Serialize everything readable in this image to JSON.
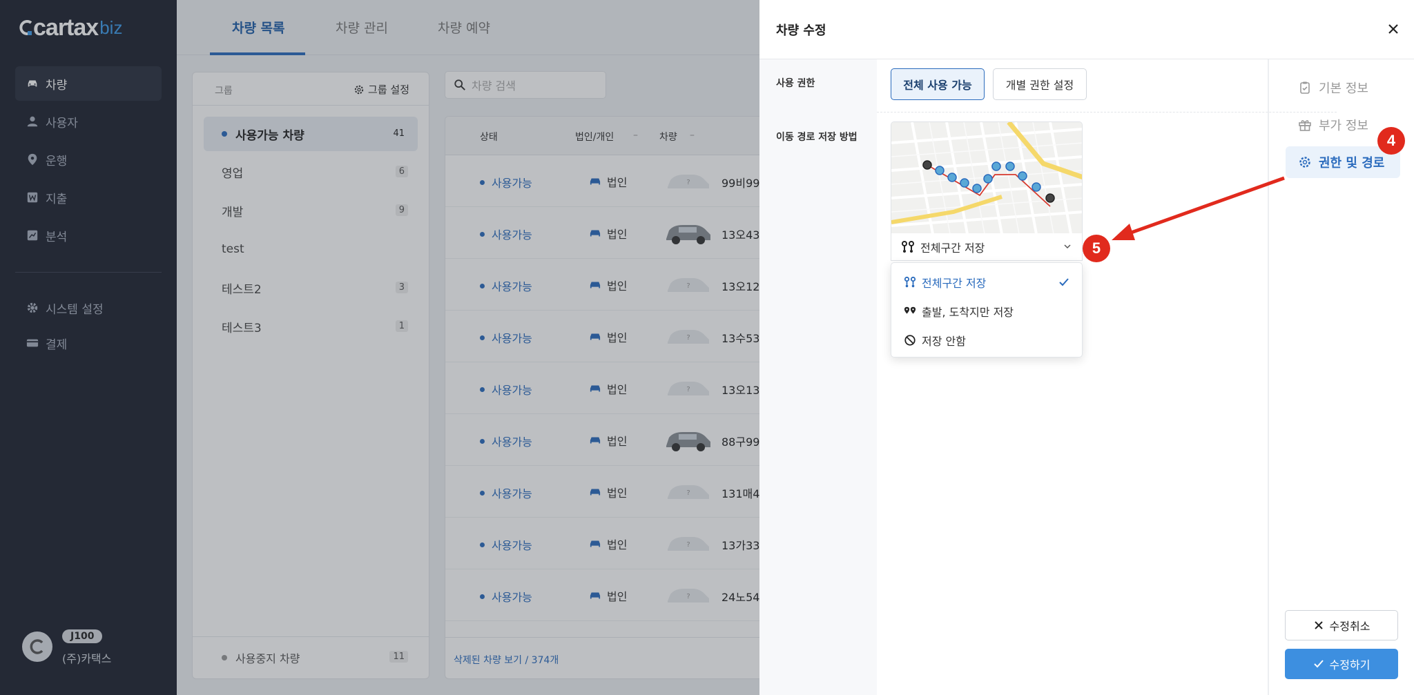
{
  "sidebar": {
    "logo": {
      "brand": "cartax",
      "suffix": "biz"
    },
    "items": [
      {
        "label": "차량",
        "icon": "car-icon"
      },
      {
        "label": "사용자",
        "icon": "user-icon"
      },
      {
        "label": "운행",
        "icon": "location-pin-icon"
      },
      {
        "label": "지출",
        "icon": "won-icon"
      },
      {
        "label": "분석",
        "icon": "chart-icon"
      },
      {
        "label": "시스템 설정",
        "icon": "gear-icon"
      },
      {
        "label": "결제",
        "icon": "card-icon"
      }
    ],
    "user": {
      "plan": "J100",
      "org": "(주)카택스"
    }
  },
  "tabs": [
    "차량 목록",
    "차량 관리",
    "차량 예약"
  ],
  "groups": {
    "title": "그룹",
    "settings_label": "그룹 설정",
    "items": [
      {
        "label": "사용가능 차량",
        "count": "41"
      },
      {
        "label": "영업",
        "count": "6"
      },
      {
        "label": "개발",
        "count": "9"
      },
      {
        "label": "test",
        "count": ""
      },
      {
        "label": "테스트2",
        "count": "3"
      },
      {
        "label": "테스트3",
        "count": "1"
      }
    ],
    "stopped": {
      "label": "사용중지 차량",
      "count": "11"
    }
  },
  "search": {
    "placeholder": "차량 검색"
  },
  "list": {
    "headers": {
      "status": "상태",
      "owner": "법인/개인",
      "vehicle": "차량"
    },
    "rows": [
      {
        "status": "사용가능",
        "owner": "법인",
        "plate": "99비99"
      },
      {
        "status": "사용가능",
        "owner": "법인",
        "plate": "13오43"
      },
      {
        "status": "사용가능",
        "owner": "법인",
        "plate": "13오12"
      },
      {
        "status": "사용가능",
        "owner": "법인",
        "plate": "13수53"
      },
      {
        "status": "사용가능",
        "owner": "법인",
        "plate": "13오13"
      },
      {
        "status": "사용가능",
        "owner": "법인",
        "plate": "88구99"
      },
      {
        "status": "사용가능",
        "owner": "법인",
        "plate": "131매4"
      },
      {
        "status": "사용가능",
        "owner": "법인",
        "plate": "13가33"
      },
      {
        "status": "사용가능",
        "owner": "법인",
        "plate": "24노54"
      }
    ],
    "footer": "삭제된 차량 보기 / 374개"
  },
  "dialog": {
    "title": "차량 수정",
    "perm_label": "사용 권한",
    "perm_all": "전체 사용 가능",
    "perm_individual": "개별 권한 설정",
    "route_label": "이동 경로 저장 방법",
    "route_selected": "전체구간 저장",
    "route_options": [
      "전체구간 저장",
      "출발, 도착지만 저장",
      "저장 안함"
    ],
    "nav": [
      "기본 정보",
      "부가 정보",
      "권한 및 경로"
    ],
    "cancel": "수정취소",
    "save": "수정하기"
  },
  "annotations": {
    "step4": "4",
    "step5": "5"
  },
  "colors": {
    "accent": "#2a6bbd",
    "sidebar_bg": "#1e2330",
    "badge": "#e12a1d",
    "save_button": "#3d8fe0"
  }
}
